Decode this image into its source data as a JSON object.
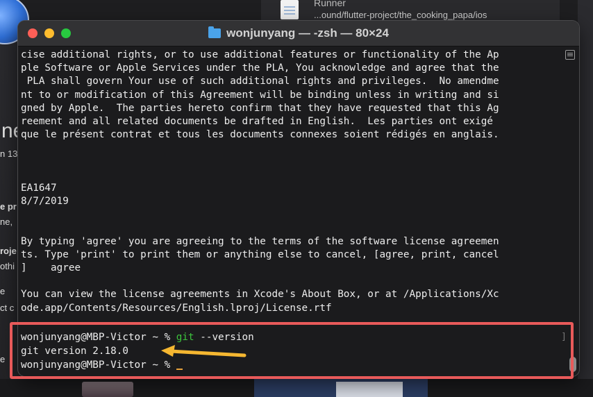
{
  "background": {
    "runner_label": "Runner",
    "path_text": "...ound/flutter-project/the_cooking_papa/ios",
    "left_fragments": [
      "ne",
      "n 13",
      "e pr",
      "ne,",
      "roje",
      "othi",
      "e",
      "ct c",
      "e"
    ]
  },
  "window": {
    "title": "wonjunyang — -zsh — 80×24"
  },
  "terminal": {
    "lines": [
      "cise additional rights, or to use additional features or functionality of the Ap",
      "ple Software or Apple Services under the PLA, You acknowledge and agree that the",
      " PLA shall govern Your use of such additional rights and privileges.  No amendme",
      "nt to or modification of this Agreement will be binding unless in writing and si",
      "gned by Apple.  The parties hereto confirm that they have requested that this Ag",
      "reement and all related documents be drafted in English.  Les parties ont exigé",
      "que le présent contrat et tous les documents connexes soient rédigés en anglais.",
      "",
      "",
      "",
      "EA1647",
      "8/7/2019",
      "",
      "",
      "By typing 'agree' you are agreeing to the terms of the software license agreemen",
      "ts. Type 'print' to print them or anything else to cancel, [agree, print, cancel",
      "]    agree",
      "",
      "You can view the license agreements in Xcode's About Box, or at /Applications/Xc",
      "ode.app/Contents/Resources/English.lproj/License.rtf"
    ],
    "prompt1": "wonjunyang@MBP-Victor ~ % ",
    "command_name": "git",
    "command_args": " --version",
    "output": "git version 2.18.0",
    "prompt2": "wonjunyang@MBP-Victor ~ % "
  },
  "colors": {
    "highlight_border": "#e85a5a",
    "arrow": "#f5b731",
    "command": "#3cc23c"
  }
}
